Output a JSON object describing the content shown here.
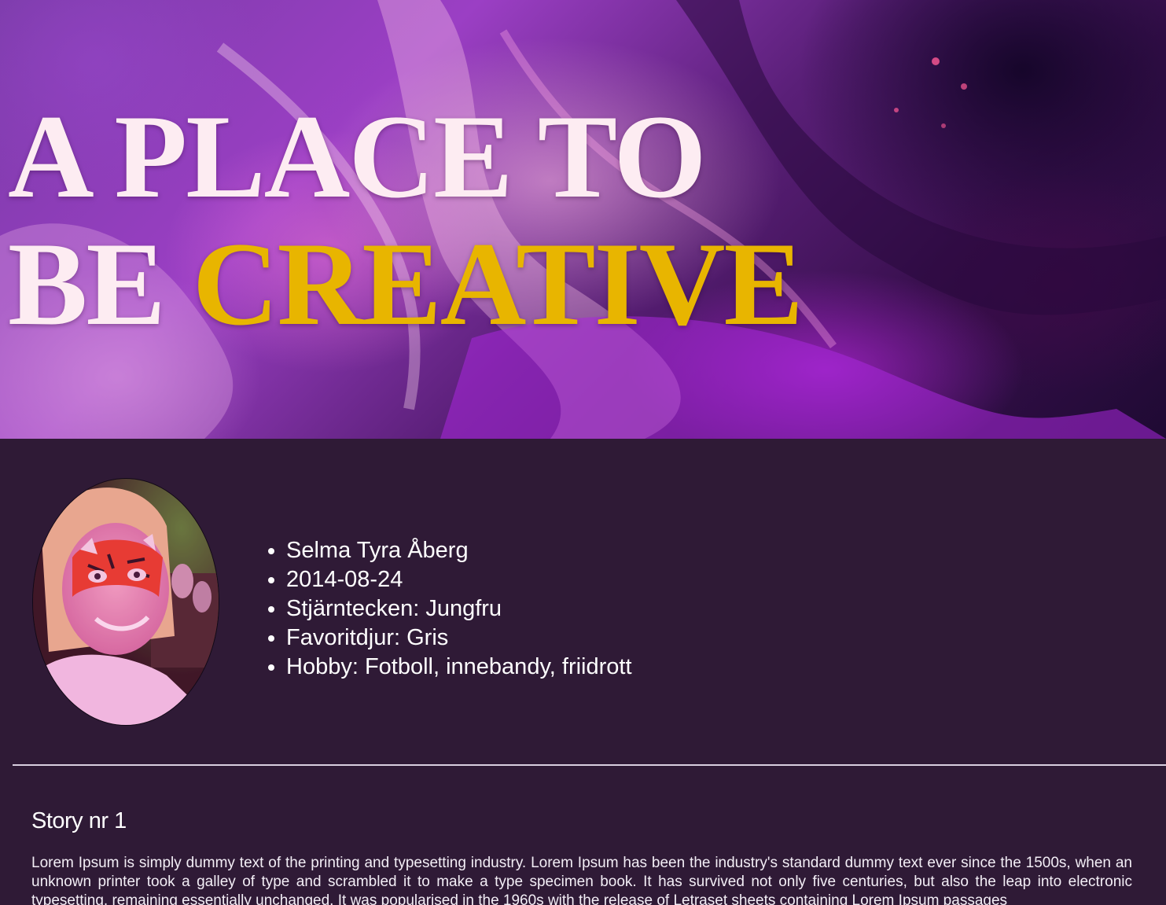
{
  "hero": {
    "title_line1": "A PLACE TO",
    "title_line2_prefix": "BE ",
    "title_line2_accent": "CREATIVE",
    "accent_color": "#e8b500",
    "title_color": "#fdecf2"
  },
  "profile": {
    "facts": [
      "Selma Tyra Åberg",
      "2014-08-24",
      "Stjärntecken: Jungfru",
      "Favoritdjur: Gris",
      "Hobby: Fotboll, innebandy, friidrott"
    ]
  },
  "story": {
    "title": "Story nr 1",
    "body": "Lorem Ipsum is simply dummy text of the printing and typesetting industry. Lorem Ipsum has been the industry's standard dummy text ever since the 1500s, when an unknown printer took a galley of type and scrambled it to make a type specimen book. It has survived not only five centuries, but also the leap into electronic typesetting, remaining essentially unchanged. It was popularised in the 1960s with the release of Letraset sheets containing Lorem Ipsum passages"
  },
  "colors": {
    "page_background": "#2f1a36",
    "divider": "#d9cfe0"
  }
}
